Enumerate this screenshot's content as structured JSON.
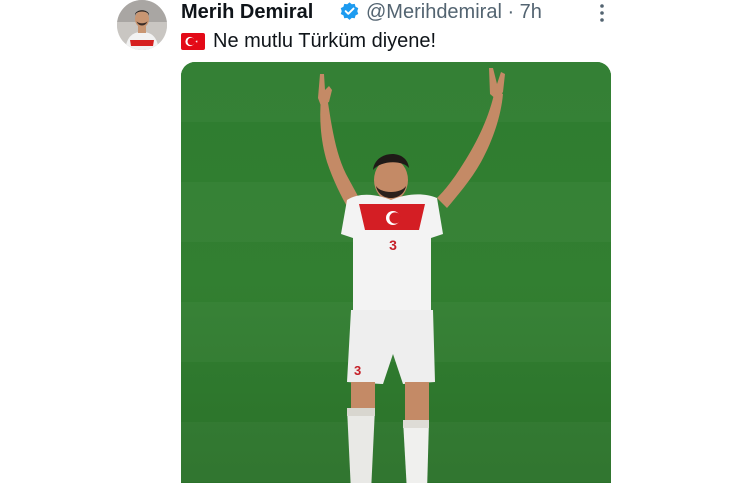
{
  "tweet": {
    "author_name": "Merih Demiral",
    "handle_time": "@Merihdemiral · 7h",
    "text": "Ne mutlu Türküm diyene!",
    "text_prefix_icon": "turkey-flag-emoji",
    "verified_icon": "verified-badge-icon",
    "more_icon": "more-options-icon"
  },
  "photo": {
    "jersey_number": "3"
  },
  "colors": {
    "primary_text": "#0f1419",
    "secondary_text": "#536471",
    "verified_blue": "#1d9bf0",
    "field_green": "#2f7a2e",
    "turkey_red": "#e30a17"
  }
}
